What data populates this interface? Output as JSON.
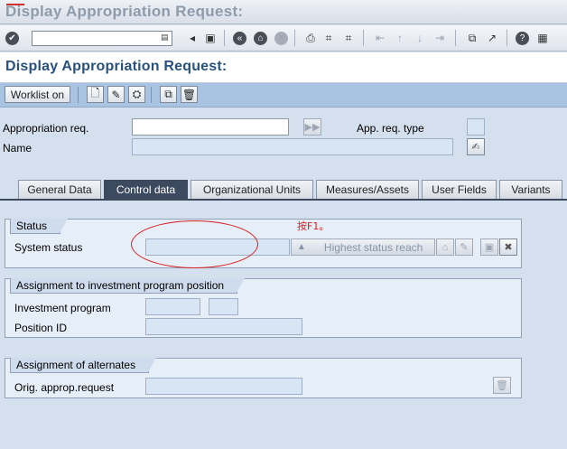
{
  "window": {
    "title": "Display Appropriation Request:"
  },
  "toolbar": {
    "icons": [
      "check-icon",
      "back-icon",
      "save-icon",
      "back-arrow-icon",
      "exit-icon",
      "cancel-icon",
      "print-icon",
      "find-icon",
      "find-next-icon",
      "first-page-icon",
      "previous-page-icon",
      "next-page-icon",
      "last-page-icon",
      "new-session-icon",
      "shortcut-icon",
      "help-icon",
      "layout-icon"
    ]
  },
  "page": {
    "title": "Display Appropriation Request:"
  },
  "app_toolbar": {
    "worklist_label": "Worklist on"
  },
  "header_fields": {
    "appropriation_req_label": "Appropriation req.",
    "app_req_type_label": "App. req. type",
    "name_label": "Name"
  },
  "tabs": [
    {
      "label": "General Data"
    },
    {
      "label": "Control data"
    },
    {
      "label": "Organizational Units"
    },
    {
      "label": "Measures/Assets"
    },
    {
      "label": "User Fields"
    },
    {
      "label": "Variants"
    }
  ],
  "status_group": {
    "title": "Status",
    "system_status_label": "System status",
    "highest_status_label": "Highest status reach"
  },
  "annotation": {
    "note": "按F1。",
    "color": "#d81e1e"
  },
  "assignment_group": {
    "title": "Assignment to investment program position",
    "investment_program_label": "Investment program",
    "position_id_label": "Position ID"
  },
  "alternates_group": {
    "title": "Assignment of alternates",
    "orig_request_label": "Orig. approp.request"
  }
}
